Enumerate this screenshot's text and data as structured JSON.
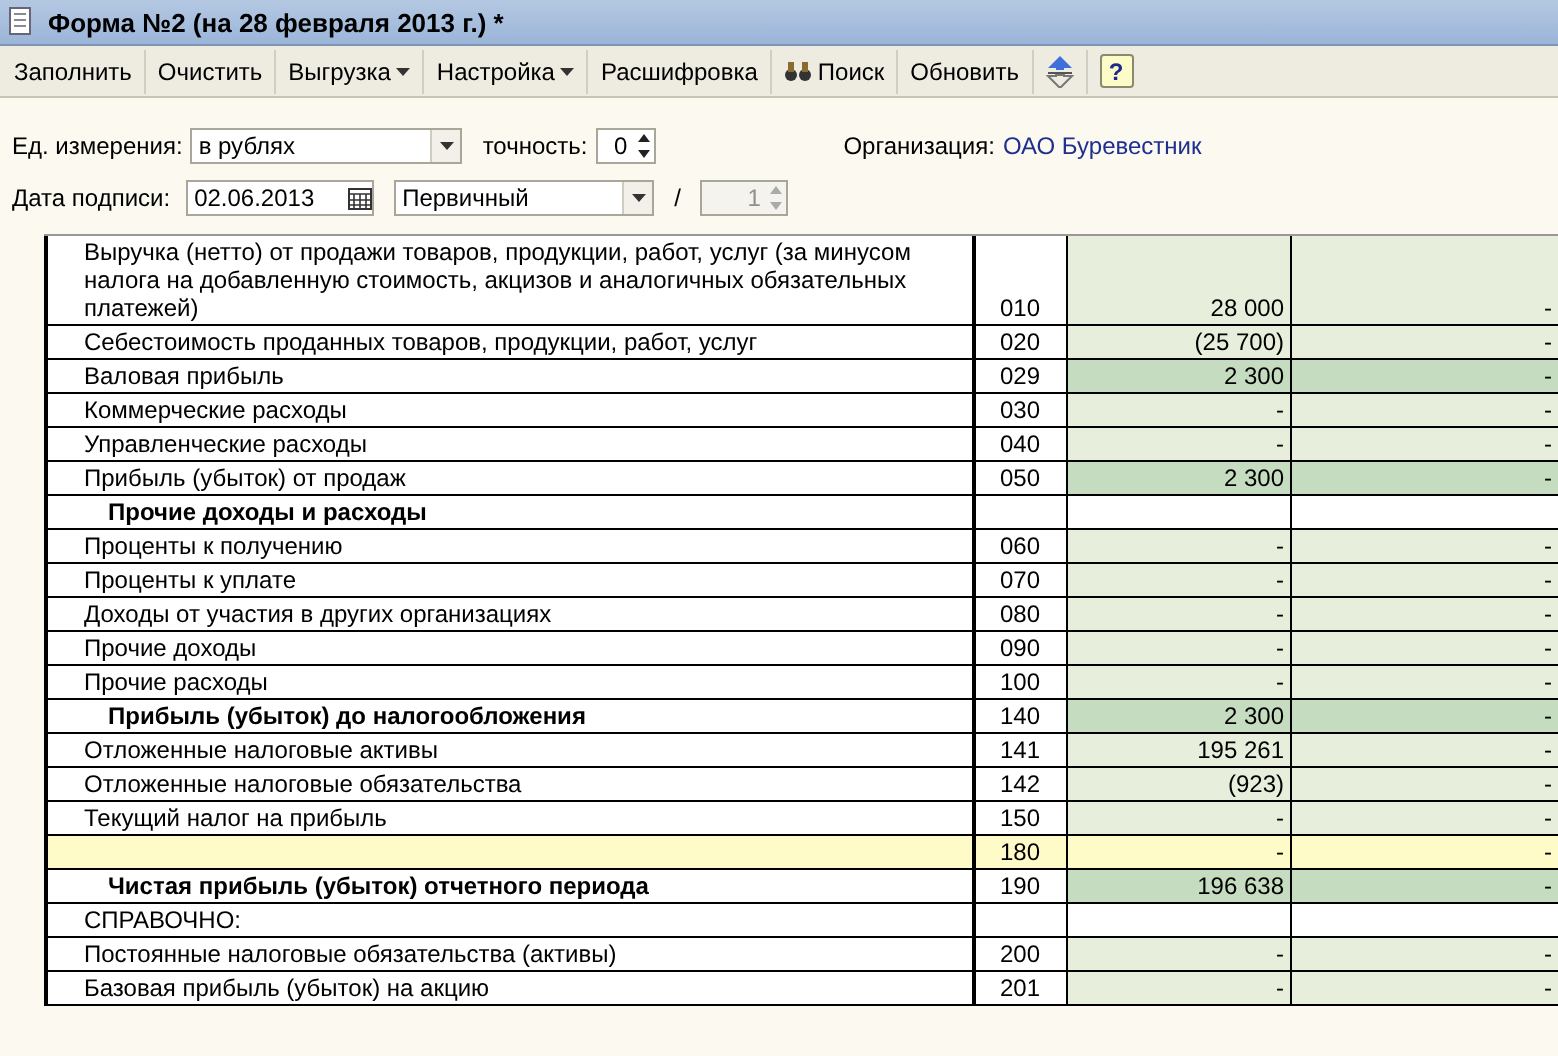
{
  "window": {
    "title": "Форма №2 (на 28 февраля 2013 г.) *"
  },
  "toolbar": [
    {
      "label": "Заполнить",
      "kind": "plain"
    },
    {
      "label": "Очистить",
      "kind": "plain"
    },
    {
      "label": "Выгрузка",
      "kind": "menu"
    },
    {
      "label": "Настройка",
      "kind": "menu"
    },
    {
      "label": "Расшифровка",
      "kind": "plain"
    },
    {
      "label": "Поиск",
      "kind": "search"
    },
    {
      "label": "Обновить",
      "kind": "plain"
    },
    {
      "kind": "collapse"
    },
    {
      "label": "?",
      "kind": "help"
    }
  ],
  "units": {
    "label": "Ед. измерения:",
    "value": "в рублях"
  },
  "precision": {
    "label": "точность:",
    "value": "0"
  },
  "organization": {
    "label": "Организация:",
    "value": "ОАО Буревестник"
  },
  "sign_date": {
    "label": "Дата подписи:",
    "value": "02.06.2013"
  },
  "report_type": {
    "value": "Первичный"
  },
  "separator": "/",
  "correction": {
    "value": "1",
    "disabled": true
  },
  "rows": [
    {
      "kind": "line",
      "label": "Выручка (нетто) от продажи товаров, продукции, работ, услуг (за минусом налога на добавленную стоимость, акцизов и аналогичных обязательных платежей)",
      "code": "010",
      "values": [
        "28 000",
        "-"
      ]
    },
    {
      "kind": "line",
      "label": "Себестоимость проданных товаров, продукции, работ, услуг",
      "code": "020",
      "values": [
        "(25 700)",
        "-"
      ]
    },
    {
      "kind": "total",
      "label": "Валовая прибыль",
      "code": "029",
      "values": [
        "2 300",
        "-"
      ]
    },
    {
      "kind": "line",
      "label": "Коммерческие расходы",
      "code": "030",
      "values": [
        "-",
        "-"
      ]
    },
    {
      "kind": "line",
      "label": "Управленческие расходы",
      "code": "040",
      "values": [
        "-",
        "-"
      ]
    },
    {
      "kind": "total",
      "label": "Прибыль (убыток) от продаж",
      "code": "050",
      "values": [
        "2 300",
        "-"
      ]
    },
    {
      "kind": "section",
      "label": "Прочие доходы и расходы"
    },
    {
      "kind": "line",
      "label": "Проценты к получению",
      "code": "060",
      "values": [
        "-",
        "-"
      ]
    },
    {
      "kind": "line",
      "label": "Проценты к уплате",
      "code": "070",
      "values": [
        "-",
        "-"
      ]
    },
    {
      "kind": "line",
      "label": "Доходы от участия в других организациях",
      "code": "080",
      "values": [
        "-",
        "-"
      ]
    },
    {
      "kind": "line",
      "label": "Прочие доходы",
      "code": "090",
      "values": [
        "-",
        "-"
      ]
    },
    {
      "kind": "line",
      "label": "Прочие расходы",
      "code": "100",
      "values": [
        "-",
        "-"
      ]
    },
    {
      "kind": "boldtotal",
      "label": "Прибыль (убыток) до налогообложения",
      "code": "140",
      "values": [
        "2 300",
        "-"
      ]
    },
    {
      "kind": "line",
      "label": "Отложенные налоговые активы",
      "code": "141",
      "values": [
        "195 261",
        "-"
      ]
    },
    {
      "kind": "line",
      "label": "Отложенные налоговые обязательства",
      "code": "142",
      "values": [
        "(923)",
        "-"
      ]
    },
    {
      "kind": "line",
      "label": "Текущий налог на прибыль",
      "code": "150",
      "values": [
        "-",
        "-"
      ]
    },
    {
      "kind": "blank",
      "code": "180",
      "values": [
        "-",
        "-"
      ]
    },
    {
      "kind": "boldtotal",
      "label": "Чистая прибыль (убыток) отчетного периода",
      "code": "190",
      "values": [
        "196 638",
        "-"
      ]
    },
    {
      "kind": "note",
      "label": "СПРАВОЧНО:"
    },
    {
      "kind": "line",
      "label": "Постоянные налоговые обязательства (активы)",
      "code": "200",
      "values": [
        "-",
        "-"
      ]
    },
    {
      "kind": "line",
      "label": "Базовая прибыль (убыток) на акцию",
      "code": "201",
      "values": [
        "-",
        "-"
      ]
    }
  ]
}
